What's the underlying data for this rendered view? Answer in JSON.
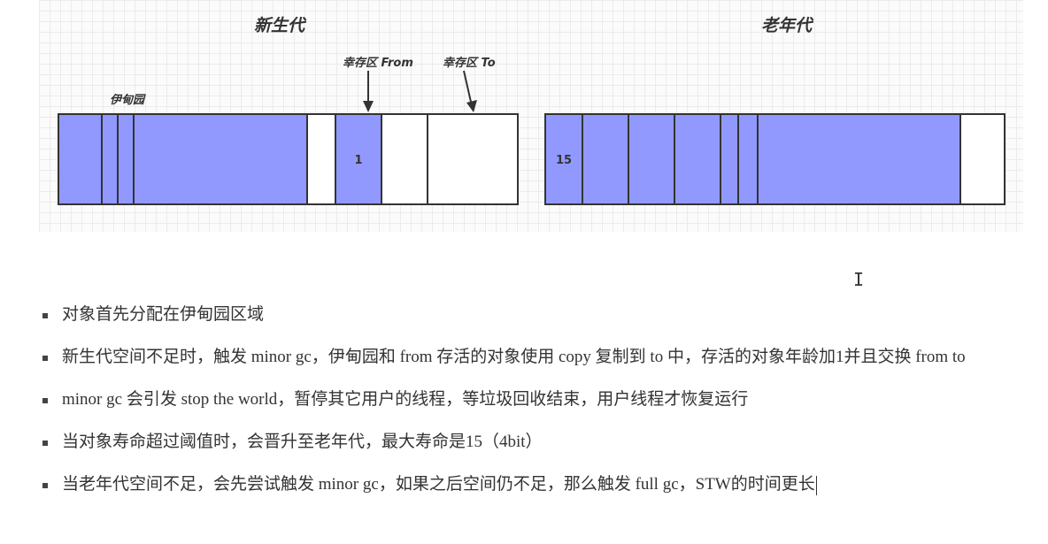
{
  "diagram": {
    "young_gen_title": "新生代",
    "old_gen_title": "老年代",
    "eden_label": "伊甸园",
    "survivor_from_label": "幸存区 From",
    "survivor_to_label": "幸存区 To",
    "from_cell_age": "1",
    "old_cell_age": "15",
    "fill_color": "#9199ff"
  },
  "bullets": [
    "对象首先分配在伊甸园区域",
    "新生代空间不足时，触发 minor gc，伊甸园和 from 存活的对象使用 copy 复制到 to 中，存活的对象年龄加1并且交换 from to",
    "minor gc 会引发 stop the world，暂停其它用户的线程，等垃圾回收结束，用户线程才恢复运行",
    "当对象寿命超过阈值时，会晋升至老年代，最大寿命是15（4bit）",
    "当老年代空间不足，会先尝试触发 minor gc，如果之后空间仍不足，那么触发 full gc，STW的时间更长"
  ],
  "cursor_icon": "text-cursor-icon"
}
